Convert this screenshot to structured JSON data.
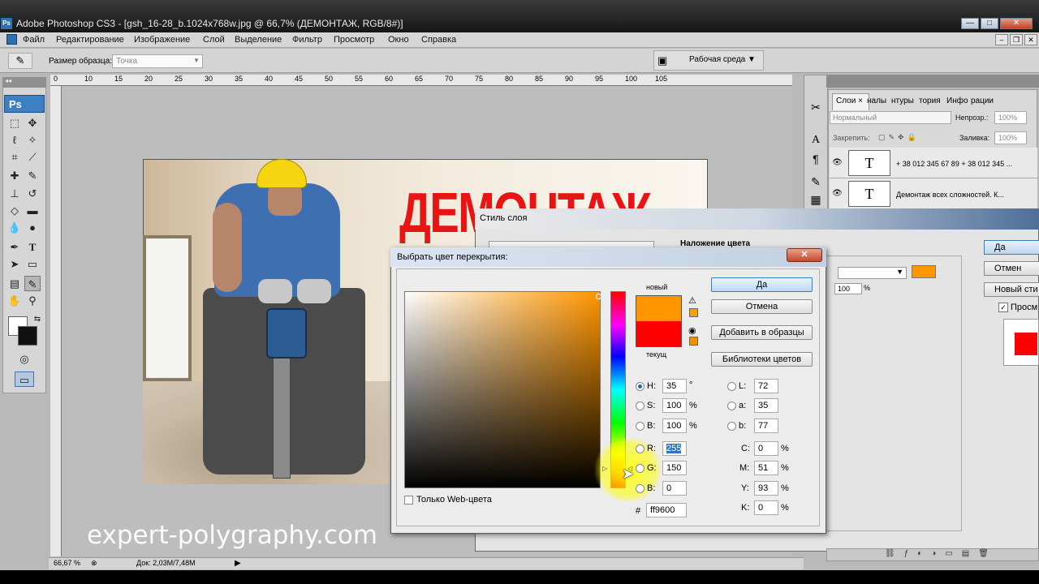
{
  "window": {
    "title": "Adobe Photoshop CS3 - [gsh_16-28_b.1024x768w.jpg @ 66,7% (ДЕМОНТАЖ, RGB/8#)]",
    "app_badge": "Ps",
    "min": "—",
    "max": "□",
    "close": "✕"
  },
  "menu": [
    "Файл",
    "Редактирование",
    "Изображение",
    "Слой",
    "Выделение",
    "Фильтр",
    "Просмотр",
    "Окно",
    "Справка"
  ],
  "options_bar": {
    "sample_size_label": "Размер образца:",
    "sample_size_value": "Точка",
    "workspace_label": "Рабочая среда ▼"
  },
  "toolbox": {
    "logo": "Ps"
  },
  "ruler": {
    "ticks": [
      "0",
      "10",
      "15",
      "20",
      "25",
      "30",
      "35",
      "40",
      "45",
      "50",
      "55",
      "60",
      "65",
      "70",
      "75",
      "80",
      "85",
      "90",
      "95",
      "100",
      "105"
    ]
  },
  "document": {
    "headline": "ДЕМОНТАЖ",
    "watermark": "expert-polygraphy.com"
  },
  "status_bar": {
    "zoom": "66,67 %",
    "doc": "Док: 2,03M/7,48M"
  },
  "layers_panel": {
    "tabs": [
      "Слои ×",
      "налы",
      "нтуры",
      "тория",
      "Инфо",
      "рации"
    ],
    "blend_mode": "Нормальный",
    "opacity_label": "Непрозр.:",
    "opacity_value": "100%",
    "lock_label": "Закрепить:",
    "fill_label": "Заливка:",
    "fill_value": "100%",
    "layers": [
      {
        "thumb": "T",
        "name": "+ 38 012 345 67 89 + 38 012 345 ..."
      },
      {
        "thumb": "T",
        "name": "Демонтаж всех сложностей. К..."
      }
    ]
  },
  "layer_style": {
    "title": "Стиль слоя",
    "section": "Наложение цвета",
    "opacity_value": "100",
    "opacity_unit": "%",
    "buttons": [
      "Да",
      "Отмен",
      "Новый сти"
    ],
    "preview_label": "Просм",
    "overlay_color": "#ff9600",
    "preview_color": "#ff0000"
  },
  "color_picker": {
    "title": "Выбрать цвет перекрытия:",
    "close": "✕",
    "new_label": "новый",
    "current_label": "текущ",
    "new_color": "#ff9600",
    "current_color": "#ff0000",
    "buttons": {
      "ok": "Да",
      "cancel": "Отмена",
      "add_swatches": "Добавить в образцы",
      "libraries": "Библиотеки цветов"
    },
    "fields": {
      "H": {
        "label": "H:",
        "value": "35",
        "unit": "°"
      },
      "S": {
        "label": "S:",
        "value": "100",
        "unit": "%"
      },
      "B": {
        "label": "B:",
        "value": "100",
        "unit": "%"
      },
      "R": {
        "label": "R:",
        "value": "255"
      },
      "G": {
        "label": "G:",
        "value": "150"
      },
      "Bl": {
        "label": "B:",
        "value": "0"
      },
      "L": {
        "label": "L:",
        "value": "72"
      },
      "a": {
        "label": "a:",
        "value": "35"
      },
      "b": {
        "label": "b:",
        "value": "77"
      },
      "C": {
        "label": "C:",
        "value": "0",
        "unit": "%"
      },
      "M": {
        "label": "M:",
        "value": "51",
        "unit": "%"
      },
      "Y": {
        "label": "Y:",
        "value": "93",
        "unit": "%"
      },
      "K": {
        "label": "K:",
        "value": "0",
        "unit": "%"
      }
    },
    "web_only_label": "Только Web-цвета",
    "hex_prefix": "#",
    "hex": "ff9600"
  }
}
